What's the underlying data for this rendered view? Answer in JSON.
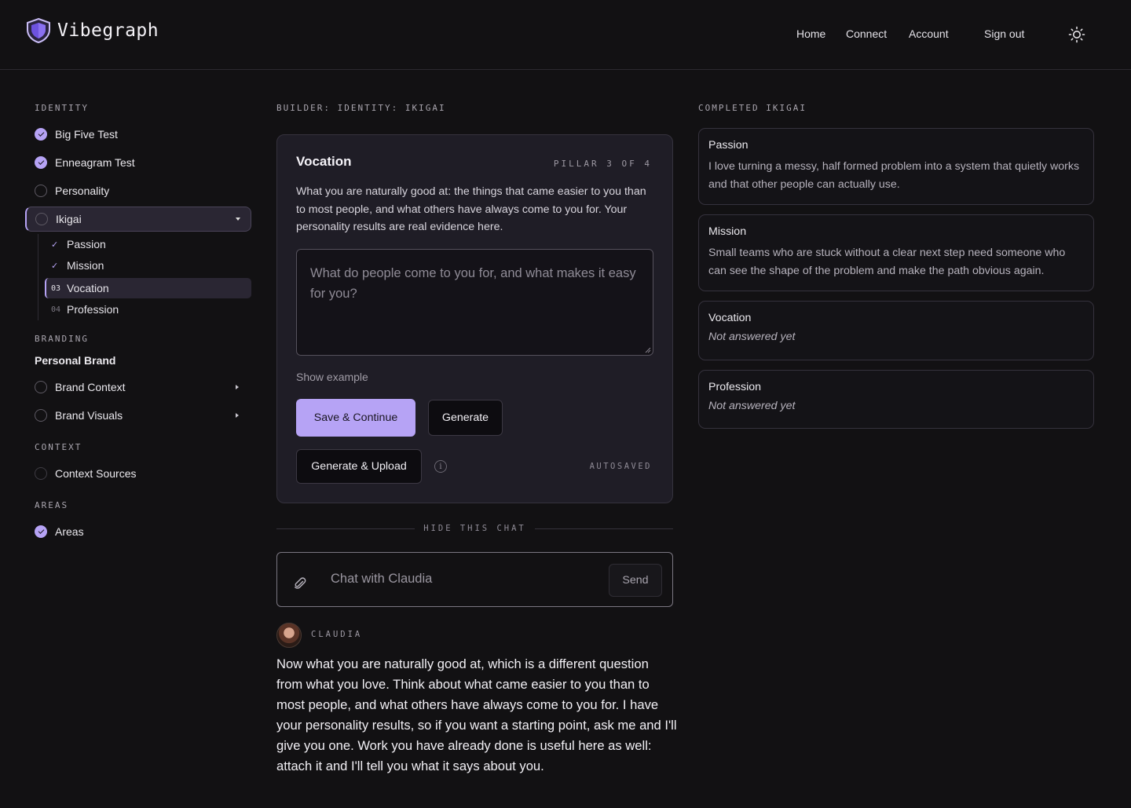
{
  "brand": {
    "name": "Vibegraph",
    "accent": "#b6a3f5"
  },
  "nav": {
    "home": "Home",
    "connect": "Connect",
    "account": "Account",
    "sign_out": "Sign out",
    "theme_icon": "sun-icon"
  },
  "sidebar": {
    "identity_label": "IDENTITY",
    "items": [
      {
        "label": "Big Five Test",
        "status": "done"
      },
      {
        "label": "Enneagram Test",
        "status": "done"
      },
      {
        "label": "Personality",
        "status": "todo"
      },
      {
        "label": "Ikigai",
        "status": "todo"
      }
    ],
    "ikigai_sub": [
      {
        "marker": "✓",
        "label": "Passion"
      },
      {
        "marker": "✓",
        "label": "Mission"
      },
      {
        "marker": "03",
        "label": "Vocation"
      },
      {
        "marker": "04",
        "label": "Profession"
      }
    ],
    "branding_label": "BRANDING",
    "personal_brand": "Personal Brand",
    "brand_context": "Brand Context",
    "brand_visuals": "Brand Visuals",
    "context_label": "CONTEXT",
    "context_sources": "Context Sources",
    "areas_label": "AREAS",
    "areas": "Areas"
  },
  "main": {
    "breadcrumb": "BUILDER: IDENTITY: IKIGAI",
    "card_title": "Vocation",
    "pillar": "PILLAR 3 OF 4",
    "description": "What you are naturally good at: the things that came easier to you than to most people, and what others have always come to you for. Your personality results are real evidence here.",
    "placeholder": "What do people come to you for, and what makes it easy for you?",
    "show_example": "Show example",
    "save_continue": "Save & Continue",
    "generate": "Generate",
    "generate_upload": "Generate & Upload",
    "info_icon": "i",
    "autosaved": "AUTOSAVED",
    "hide_chat": "HIDE THIS CHAT",
    "chat_placeholder": "Chat with Claudia",
    "send": "Send",
    "assistant_name": "CLAUDIA",
    "assistant_message": "Now what you are naturally good at, which is a different question from what you love. Think about what came easier to you than to most people, and what others have always come to you for. I have your personality results, so if you want a starting point, ask me and I'll give you one. Work you have already done is useful here as well: attach it and I'll tell you what it says about you."
  },
  "completed": {
    "label": "COMPLETED IKIGAI",
    "passion": {
      "title": "Passion",
      "body": "I love turning a messy, half formed problem into a system that quietly works and that other people can actually use."
    },
    "mission": {
      "title": "Mission",
      "body": "Small teams who are stuck without a clear next step need someone who can see the shape of the problem and make the path obvious again."
    },
    "vocation": {
      "title": "Vocation",
      "body": "Not answered yet"
    },
    "profession": {
      "title": "Profession",
      "body": "Not answered yet"
    }
  }
}
